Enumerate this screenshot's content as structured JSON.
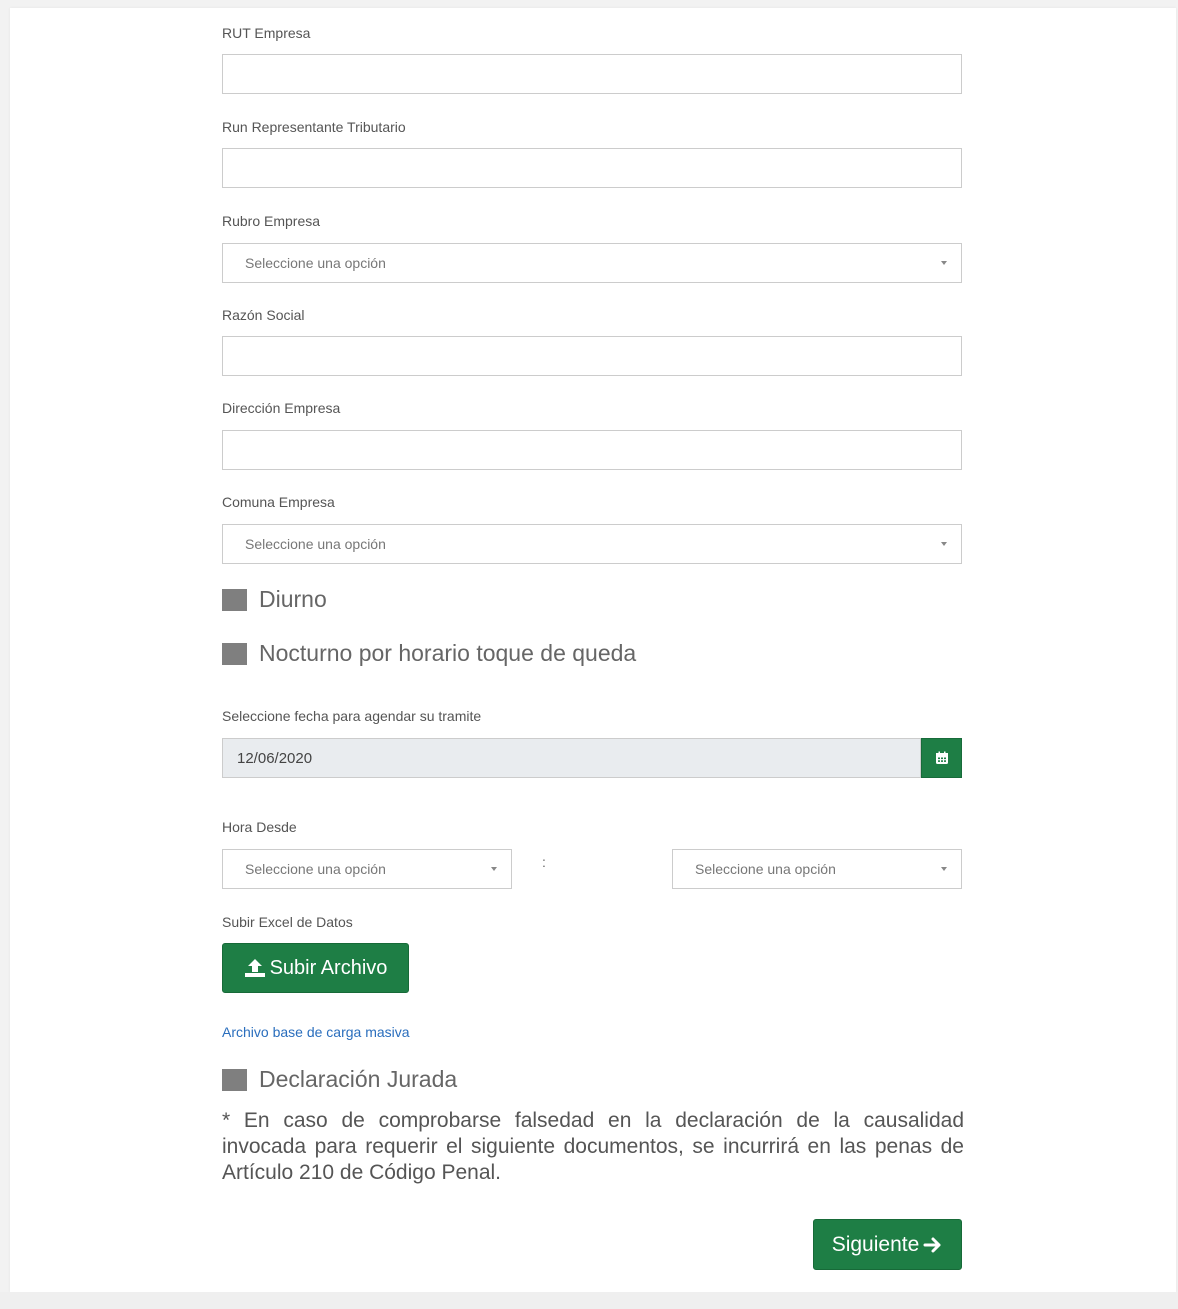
{
  "fields": {
    "rut_empresa": {
      "label": "RUT Empresa",
      "value": ""
    },
    "run_representante": {
      "label": "Run Representante Tributario",
      "value": ""
    },
    "rubro_empresa": {
      "label": "Rubro Empresa",
      "selected": "Seleccione una opción"
    },
    "razon_social": {
      "label": "Razón Social",
      "value": ""
    },
    "direccion_empresa": {
      "label": "Dirección Empresa",
      "value": ""
    },
    "comuna_empresa": {
      "label": "Comuna Empresa",
      "selected": "Seleccione una opción"
    }
  },
  "checkboxes": {
    "diurno": {
      "label": "Diurno",
      "checked": false
    },
    "nocturno": {
      "label": "Nocturno por horario toque de queda",
      "checked": false
    },
    "declaracion": {
      "label": "Declaración Jurada",
      "checked": false
    }
  },
  "fecha": {
    "label": "Seleccione fecha para agendar su tramite",
    "value": "12/06/2020",
    "icon": "calendar-icon"
  },
  "hora_desde": {
    "label": "Hora Desde",
    "hour_selected": "Seleccione una opción",
    "separator": ":",
    "minute_selected": "Seleccione una opción"
  },
  "upload": {
    "label": "Subir Excel de Datos",
    "button_label": "Subir Archivo",
    "icon": "upload-icon"
  },
  "template_link": "Archivo base de carga masiva",
  "notice": "* En caso de comprobarse falsedad en la declaración de la causalidad invocada para requerir el siguiente documentos, se incurrirá en las penas de Artículo 210 de Código Penal.",
  "next_button": {
    "label": "Siguiente",
    "icon": "arrow-right-icon"
  },
  "colors": {
    "primary_green": "#1e7e45",
    "checkbox_gray": "#7f7f7f",
    "link_blue": "#2a6ebd",
    "disabled_input_bg": "#e9ecef"
  }
}
